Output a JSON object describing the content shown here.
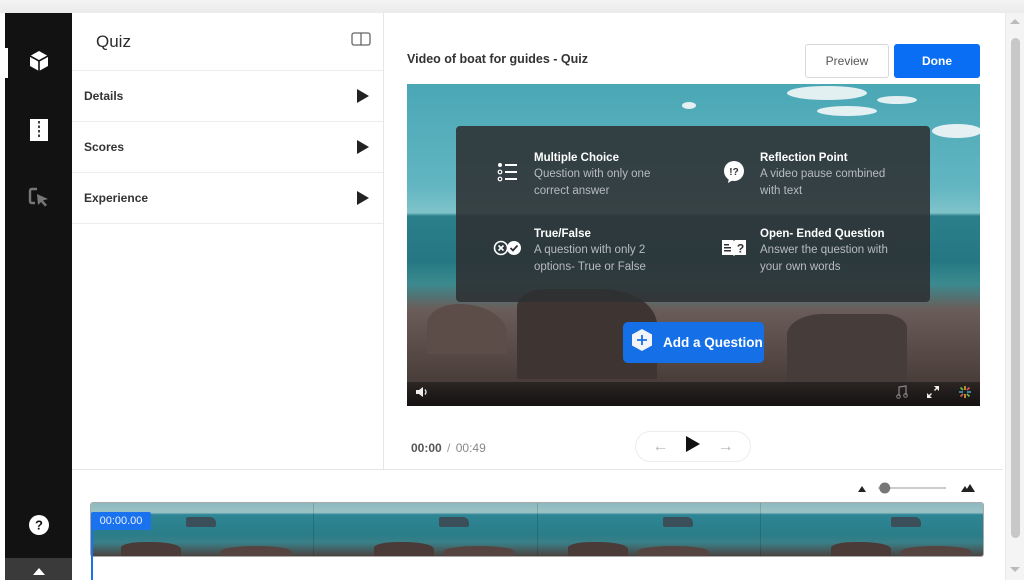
{
  "sidebar_rail": {
    "items": [
      {
        "icon": "cube-icon",
        "active": true
      },
      {
        "icon": "chapters-icon",
        "active": false
      },
      {
        "icon": "cursor-select-icon",
        "active": false
      }
    ],
    "help_icon": "help-circle-icon",
    "back_icon": "back-arrow-icon"
  },
  "panel": {
    "title": "Quiz",
    "layout_icon": "panel-layout-icon",
    "sections": [
      {
        "label": "Details"
      },
      {
        "label": "Scores"
      },
      {
        "label": "Experience"
      }
    ]
  },
  "header": {
    "video_title": "Video of boat for guides - Quiz",
    "preview_label": "Preview",
    "done_label": "Done"
  },
  "colors": {
    "accent": "#0a6ef5",
    "rail_bg": "#121212"
  },
  "question_types": [
    {
      "name": "Multiple Choice",
      "description": "Question with only one correct answer",
      "icon": "list-icon"
    },
    {
      "name": "Reflection Point",
      "description": "A video pause combined with text",
      "icon": "reflection-icon"
    },
    {
      "name": "True/False",
      "description": "A question with only 2 options- True or False",
      "icon": "true-false-icon"
    },
    {
      "name": "Open- Ended Question",
      "description": "Answer the question with your own words",
      "icon": "open-ended-icon"
    }
  ],
  "add_question_label": "Add a Question",
  "player": {
    "current_time": "00:00",
    "separator": "/",
    "duration": "00:49"
  },
  "timeline": {
    "marker_time": "00:00.00",
    "zoom_level": 0.1
  }
}
